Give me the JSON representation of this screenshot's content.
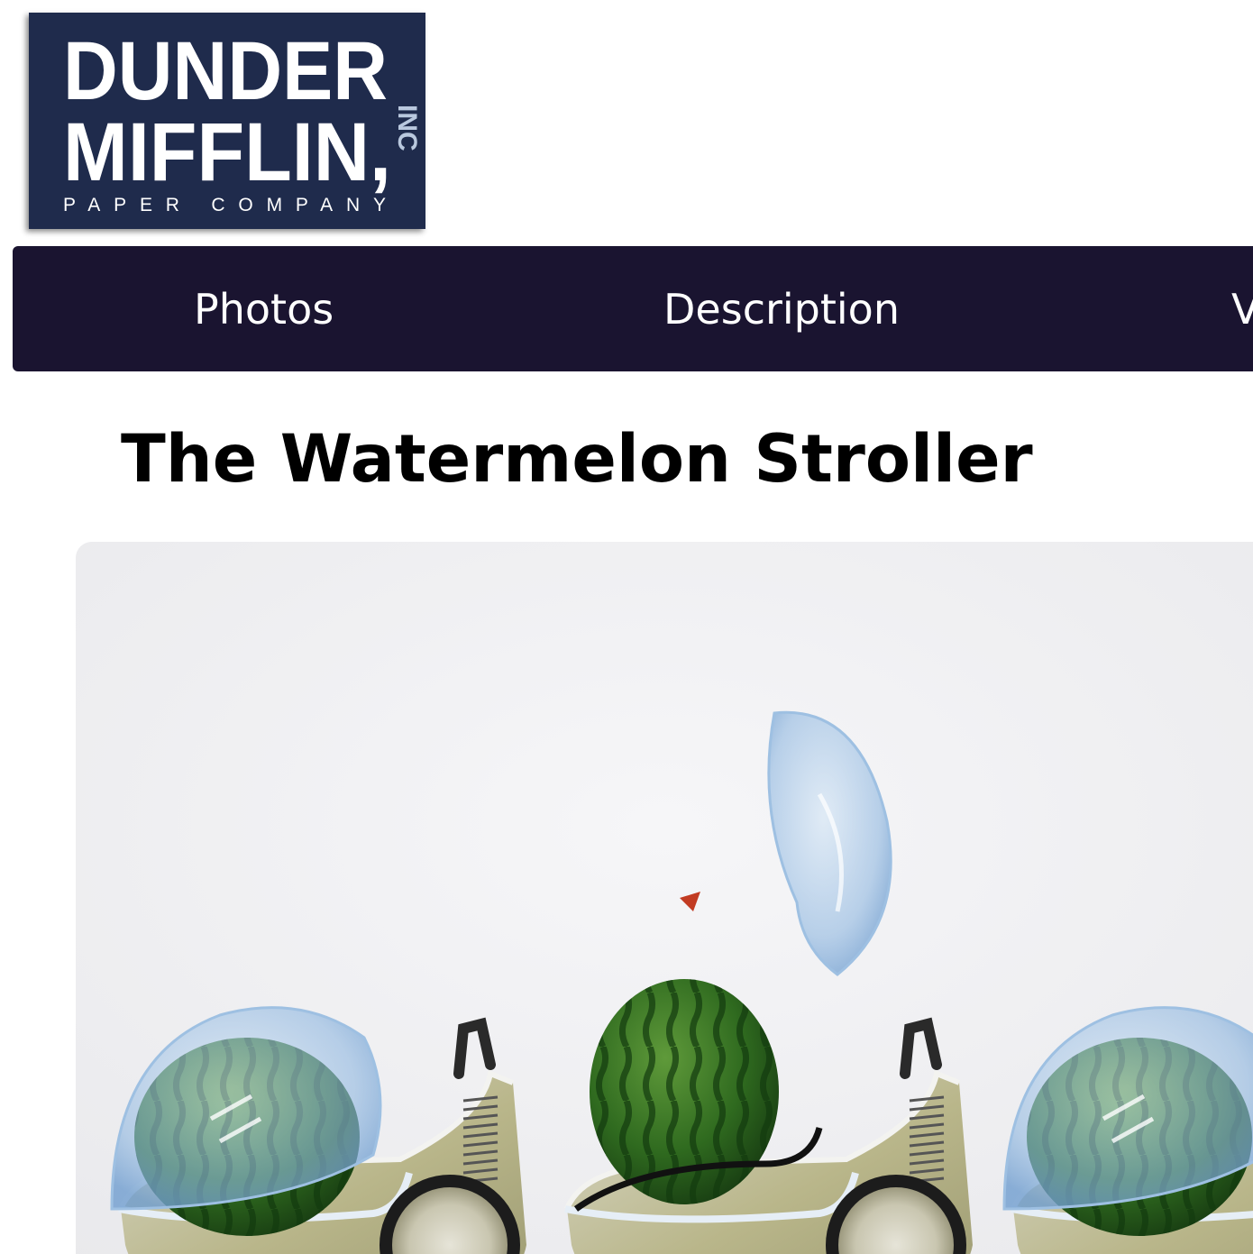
{
  "logo": {
    "line1": "DUNDER",
    "line2": "MIFFLIN,",
    "inc": "INC",
    "tagline": "PAPER COMPANY",
    "bg_color": "#1f2b4c"
  },
  "nav": {
    "bg_color": "#1a1430",
    "items": [
      {
        "label": "Photos"
      },
      {
        "label": "Description"
      },
      {
        "label": "V"
      }
    ]
  },
  "main": {
    "title": "The Watermelon Stroller"
  },
  "hero": {
    "icon": "watermelon-stroller-photo"
  }
}
